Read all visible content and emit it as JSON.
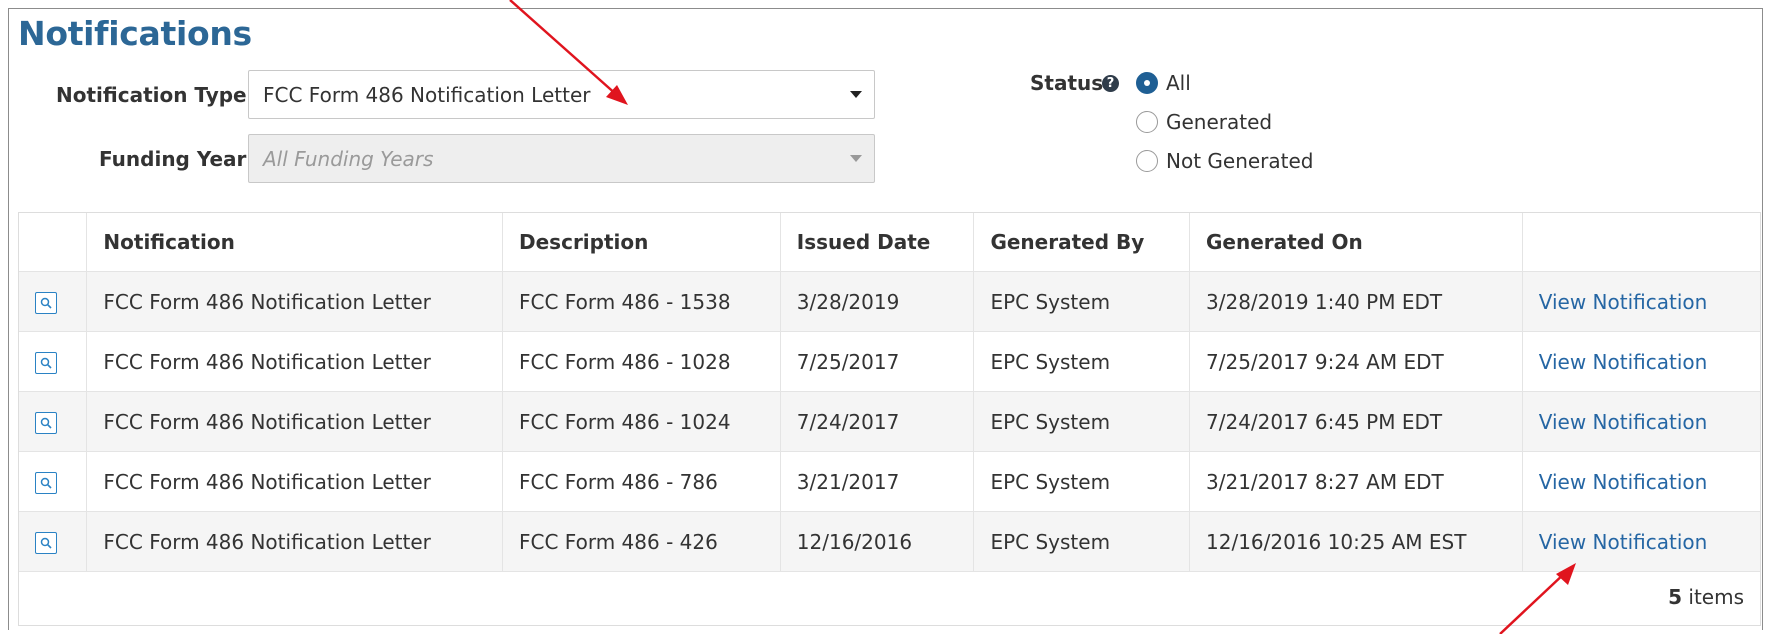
{
  "page": {
    "title": "Notifications"
  },
  "filters": {
    "notification_type_label": "Notification Type",
    "notification_type_value": "FCC Form 486 Notification Letter",
    "funding_year_label": "Funding Year",
    "funding_year_value": "All Funding Years",
    "status_label": "Status",
    "status_help": "?",
    "status_options": [
      "All",
      "Generated",
      "Not Generated"
    ],
    "status_selected": "All"
  },
  "table": {
    "columns": [
      "",
      "Notification",
      "Description",
      "Issued Date",
      "Generated By",
      "Generated On",
      ""
    ],
    "rows": [
      {
        "notification": "FCC Form 486 Notification Letter",
        "description": "FCC Form 486 - 1538",
        "issued": "3/28/2019",
        "by": "EPC System",
        "on": "3/28/2019 1:40 PM EDT",
        "action": "View Notification"
      },
      {
        "notification": "FCC Form 486 Notification Letter",
        "description": "FCC Form 486 - 1028",
        "issued": "7/25/2017",
        "by": "EPC System",
        "on": "7/25/2017 9:24 AM EDT",
        "action": "View Notification"
      },
      {
        "notification": "FCC Form 486 Notification Letter",
        "description": "FCC Form 486 - 1024",
        "issued": "7/24/2017",
        "by": "EPC System",
        "on": "7/24/2017 6:45 PM EDT",
        "action": "View Notification"
      },
      {
        "notification": "FCC Form 486 Notification Letter",
        "description": "FCC Form 486 - 786",
        "issued": "3/21/2017",
        "by": "EPC System",
        "on": "3/21/2017 8:27 AM EDT",
        "action": "View Notification"
      },
      {
        "notification": "FCC Form 486 Notification Letter",
        "description": "FCC Form 486 - 426",
        "issued": "12/16/2016",
        "by": "EPC System",
        "on": "12/16/2016 10:25 AM EST",
        "action": "View Notification"
      }
    ],
    "footer_count": "5",
    "footer_suffix": "items"
  },
  "colors": {
    "title": "#2c6796",
    "link": "#2566a4",
    "annotation_arrow": "#e0141e",
    "radio_checked": "#1f5f94"
  },
  "icons": {
    "row_preview": "magnifier-icon",
    "status_help": "question-circle-icon"
  }
}
